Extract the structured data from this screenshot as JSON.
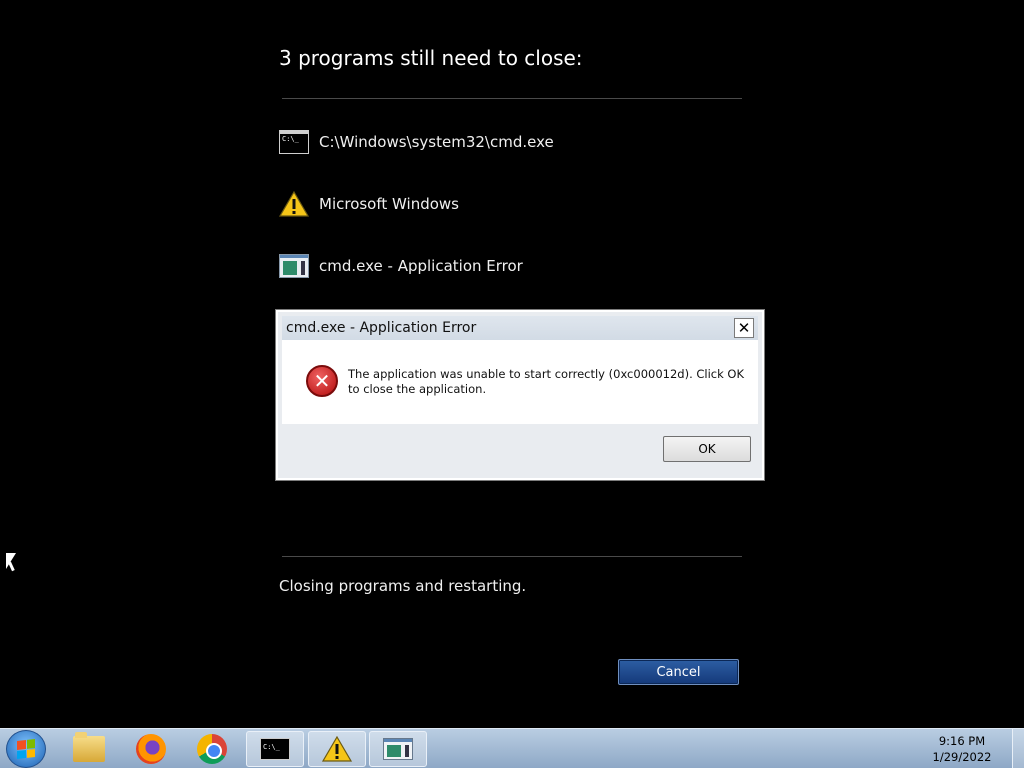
{
  "shutdown_screen": {
    "heading": "3 programs still need to close:",
    "programs": [
      {
        "icon": "cmd-window-icon",
        "label": "C:\\Windows\\system32\\cmd.exe"
      },
      {
        "icon": "warning-icon",
        "label": "Microsoft Windows"
      },
      {
        "icon": "dialog-window-icon",
        "label": "cmd.exe - Application Error"
      }
    ],
    "status_text": "Closing programs and restarting.",
    "cancel_label": "Cancel"
  },
  "error_dialog": {
    "title": "cmd.exe - Application Error",
    "close_glyph": "✕",
    "message": "The application was unable to start correctly (0xc000012d). Click OK to close the application.",
    "icon": "error-icon",
    "ok_label": "OK"
  },
  "taskbar": {
    "items": [
      "start-button",
      "file-explorer",
      "firefox",
      "chrome",
      "cmd",
      "microsoft-windows-warning",
      "application-error-dialog"
    ],
    "cmd_glyph": "C:\\_",
    "time": "9:16 PM",
    "date": "1/29/2022"
  },
  "colors": {
    "background": "#000000",
    "cancel_button": "#1f4c8f",
    "taskbar": "#a9c0da",
    "error_red": "#c41818",
    "warning_yellow": "#f5c518"
  }
}
